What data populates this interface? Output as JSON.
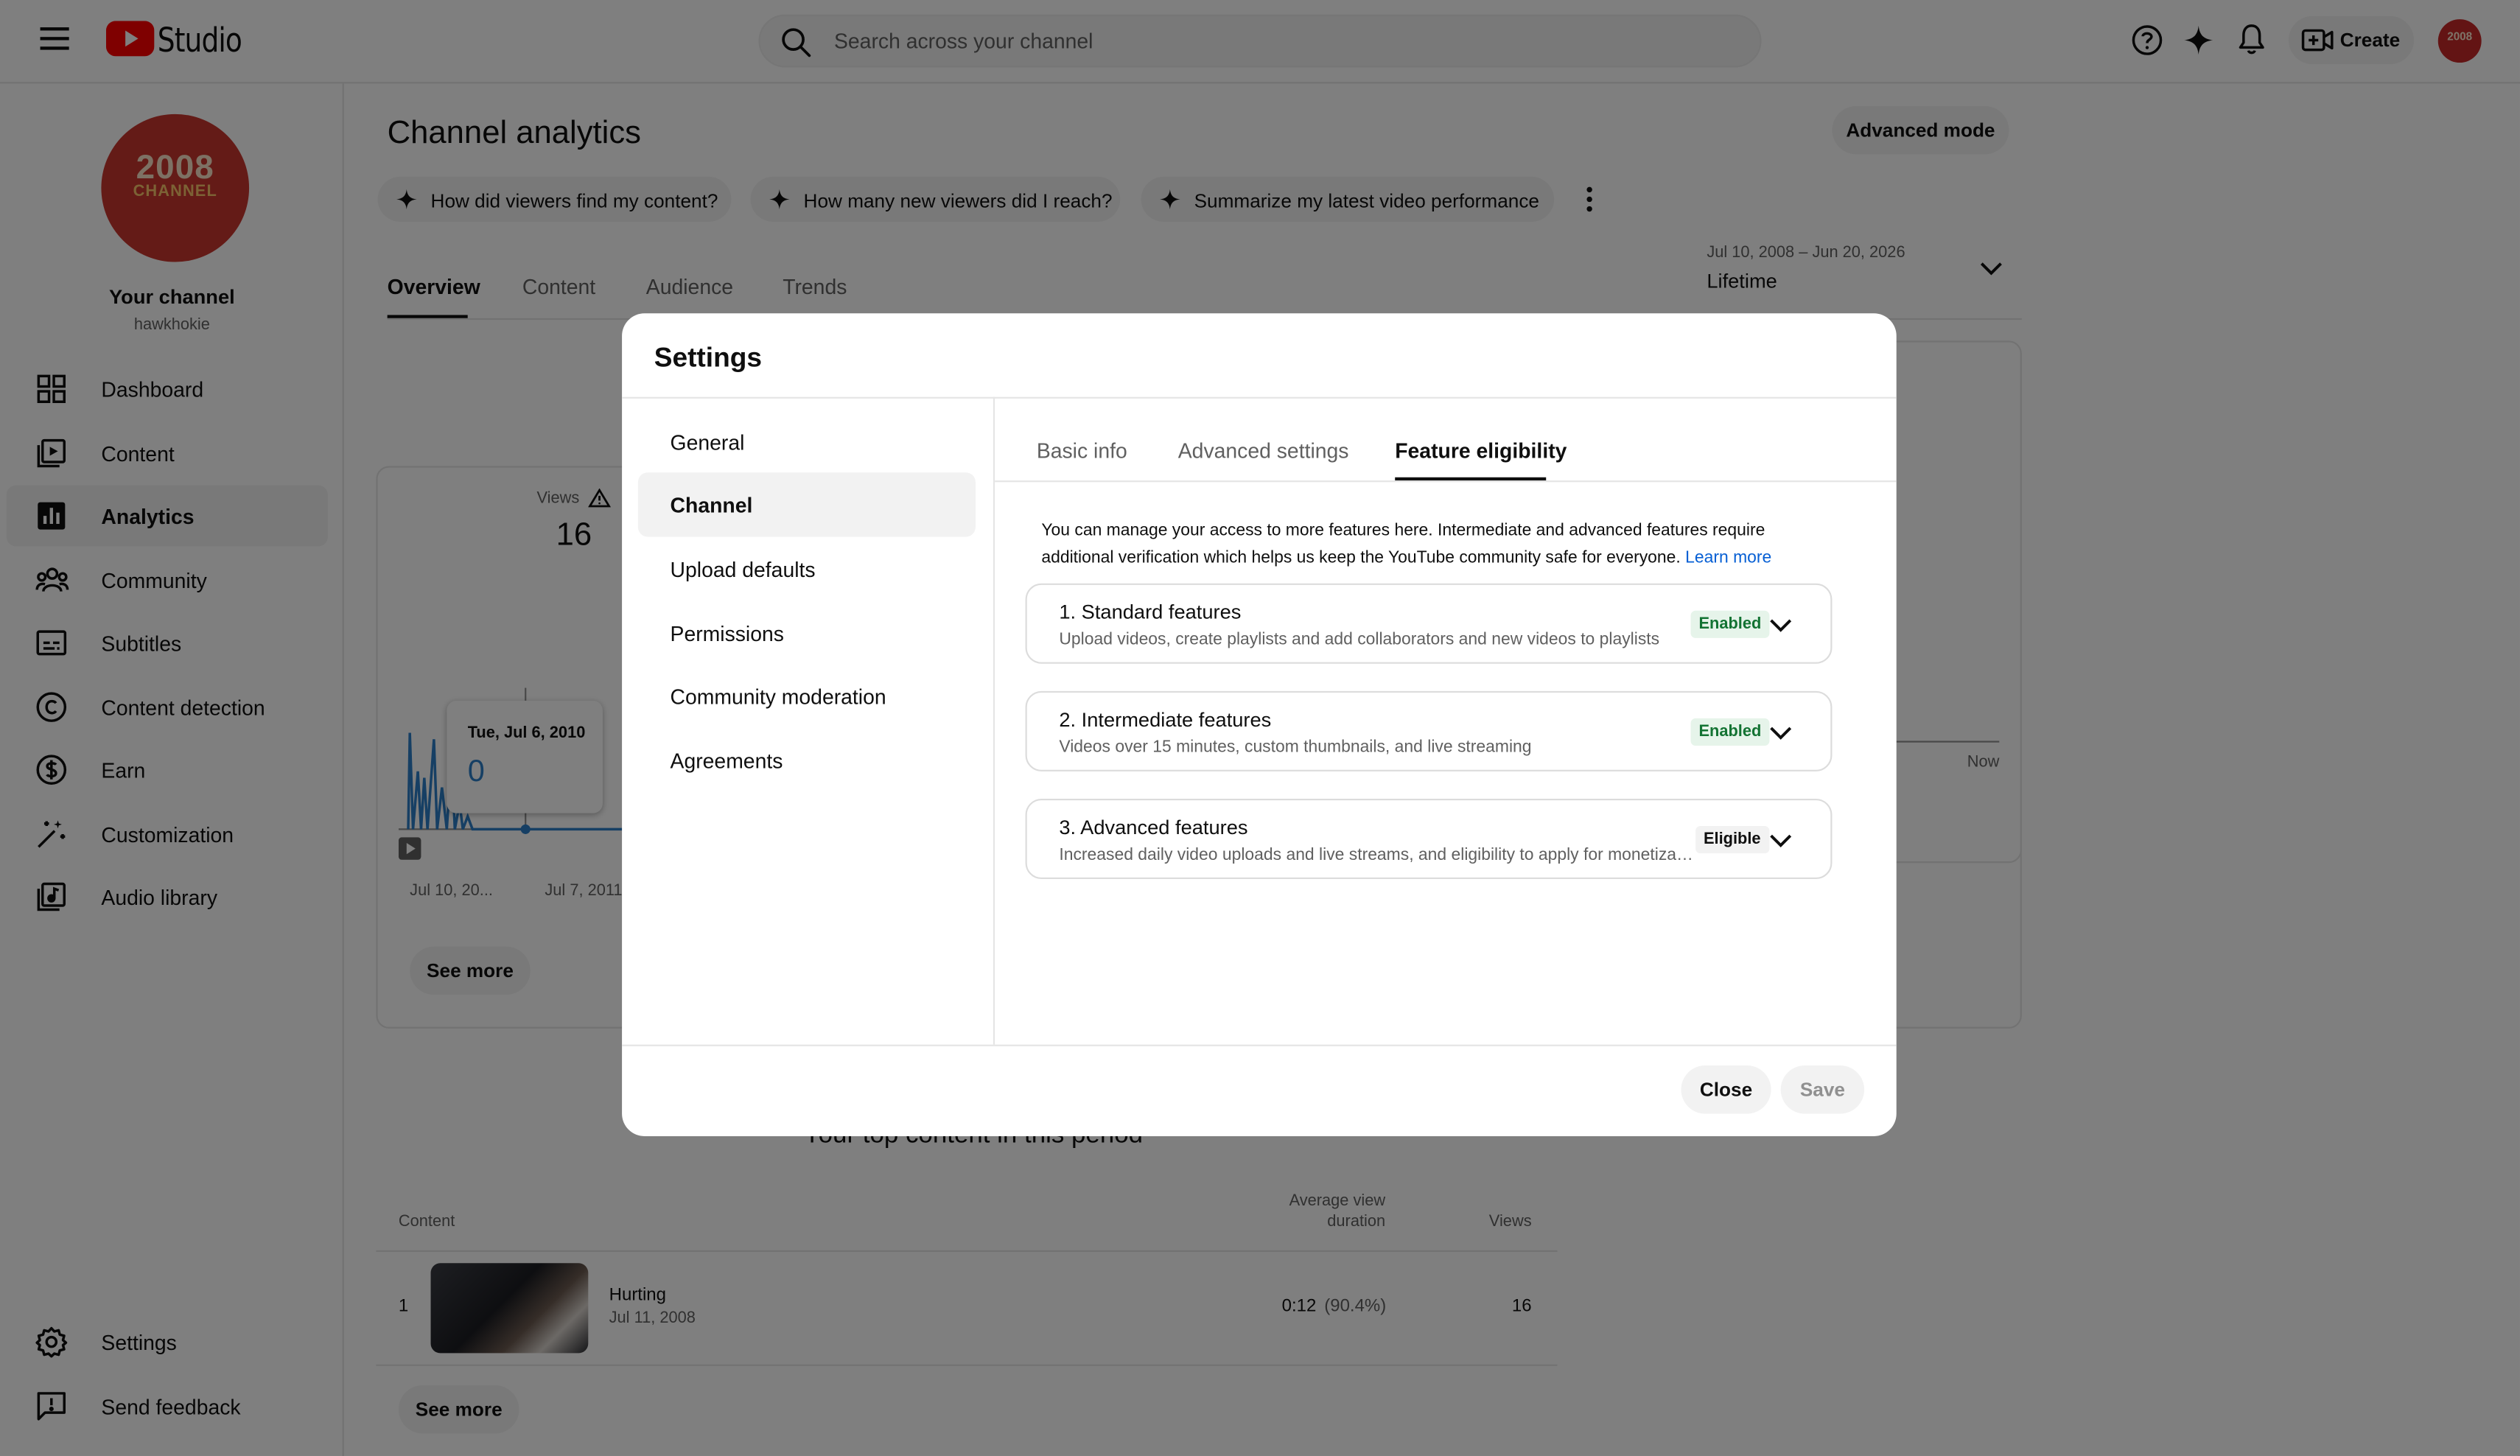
{
  "header": {
    "logo_text": "Studio",
    "search_placeholder": "Search across your channel",
    "create_label": "Create",
    "avatar_text": "2008"
  },
  "sidebar": {
    "channel_logo_top": "2008",
    "channel_logo_bottom": "CHANNEL",
    "channel_name": "Your channel",
    "channel_handle": "hawkhokie",
    "items": [
      {
        "label": "Dashboard",
        "icon": "dashboard-icon"
      },
      {
        "label": "Content",
        "icon": "content-icon"
      },
      {
        "label": "Analytics",
        "icon": "analytics-icon"
      },
      {
        "label": "Community",
        "icon": "community-icon"
      },
      {
        "label": "Subtitles",
        "icon": "subtitles-icon"
      },
      {
        "label": "Content detection",
        "icon": "copyright-icon"
      },
      {
        "label": "Earn",
        "icon": "dollar-icon"
      },
      {
        "label": "Customization",
        "icon": "magic-wand-icon"
      },
      {
        "label": "Audio library",
        "icon": "audio-library-icon"
      }
    ],
    "bottom_items": [
      {
        "label": "Settings",
        "icon": "gear-icon"
      },
      {
        "label": "Send feedback",
        "icon": "feedback-icon"
      }
    ]
  },
  "main": {
    "title": "Channel analytics",
    "advanced_mode_label": "Advanced mode",
    "chips": [
      "How did viewers find my content?",
      "How many new viewers did I reach?",
      "Summarize my latest video performance"
    ],
    "tabs": [
      "Overview",
      "Content",
      "Audience",
      "Trends"
    ],
    "date_range": "Jul 10, 2008 – Jun 20, 2026",
    "date_preset": "Lifetime",
    "views_label": "Views",
    "views_value": "16",
    "tooltip_date": "Tue, Jul 6, 2010",
    "tooltip_value": "0",
    "axis_labels": [
      "Jul 10, 20...",
      "Jul 7, 2011"
    ],
    "axis_now": "Now",
    "see_more_1": "See more",
    "top_content_heading": "Your top content in this period",
    "table": {
      "col_content": "Content",
      "col_avg_1": "Average view",
      "col_avg_2": "duration",
      "col_views": "Views",
      "rows": [
        {
          "rank": "1",
          "title": "Hurting",
          "date": "Jul 11, 2008",
          "duration": "0:12",
          "percent": "(90.4%)",
          "views": "16"
        }
      ]
    },
    "see_more_2": "See more"
  },
  "dialog": {
    "title": "Settings",
    "nav": [
      "General",
      "Channel",
      "Upload defaults",
      "Permissions",
      "Community moderation",
      "Agreements"
    ],
    "tabs": [
      "Basic info",
      "Advanced settings",
      "Feature eligibility"
    ],
    "intro_line1": "You can manage your access to more features here. Intermediate and advanced features require",
    "intro_line2": "additional verification which helps us keep the YouTube community safe for everyone.",
    "learn_more": "Learn more",
    "features": [
      {
        "title": "1. Standard features",
        "desc": "Upload videos, create playlists and add collaborators and new videos to playlists",
        "status": "Enabled"
      },
      {
        "title": "2. Intermediate features",
        "desc": "Videos over 15 minutes, custom thumbnails, and live streaming",
        "status": "Enabled"
      },
      {
        "title": "3. Advanced features",
        "desc": "Increased daily video uploads and live streams, and eligibility to apply for monetization",
        "status": "Eligible"
      }
    ],
    "close_label": "Close",
    "save_label": "Save"
  },
  "colors": {
    "brand_red": "#ff0000",
    "link_blue": "#065fd4",
    "enabled_green": "#137333"
  }
}
